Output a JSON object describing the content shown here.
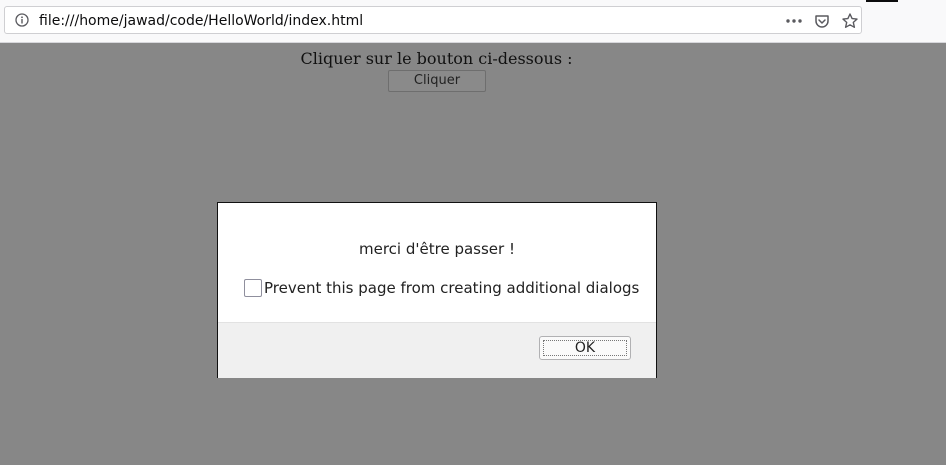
{
  "browser": {
    "url": "file:///home/jawad/code/HelloWorld/index.html",
    "icons": {
      "info": "info-icon",
      "more": "more-icon",
      "pocket": "pocket-icon",
      "bookmark": "star-icon"
    }
  },
  "page": {
    "instruction": "Cliquer sur le bouton ci-dessous :",
    "button_label": "Cliquer"
  },
  "dialog": {
    "message": "merci d'être passer !",
    "checkbox_label": "Prevent this page from creating additional dialogs",
    "checkbox_checked": false,
    "ok_label": "OK"
  },
  "colors": {
    "overlay_background": "#878787",
    "dialog_background": "#ffffff",
    "dialog_footer": "#f0f0f0"
  }
}
